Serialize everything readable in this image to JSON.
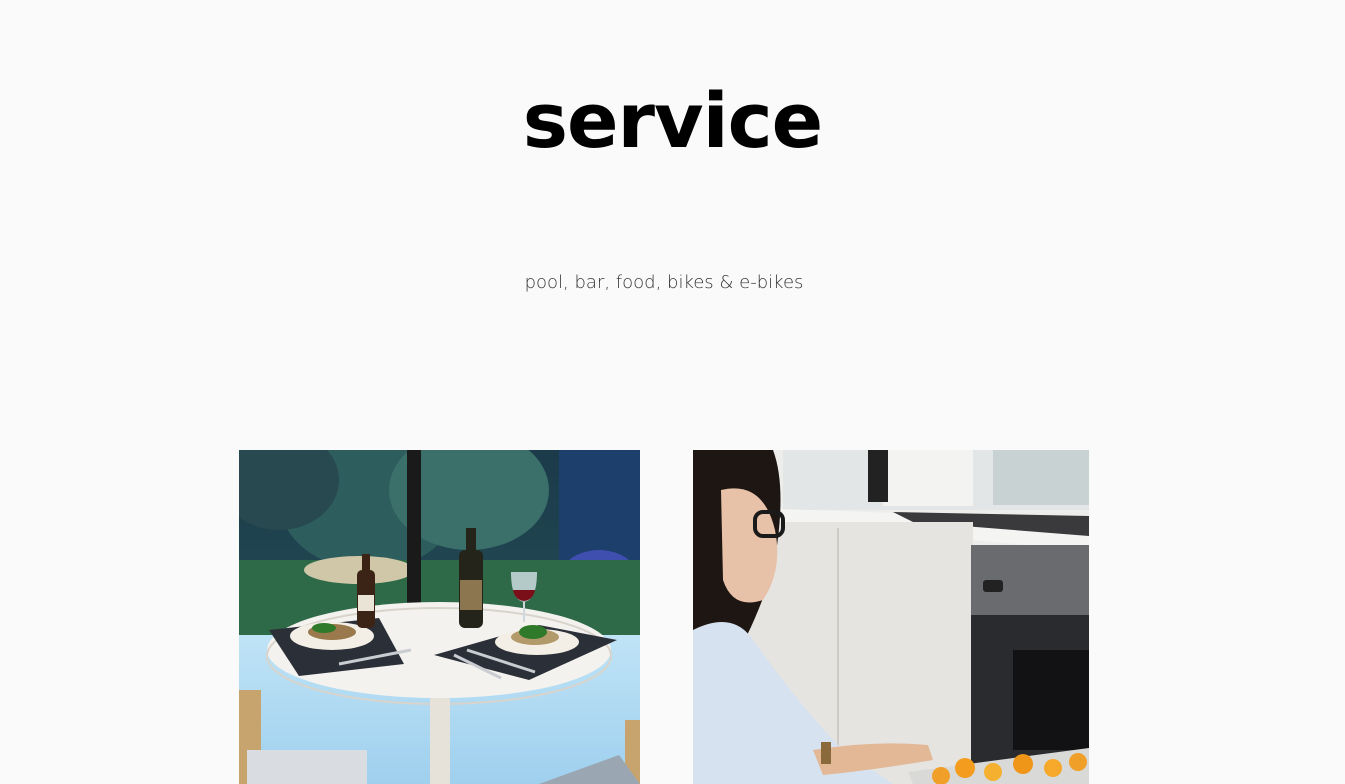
{
  "section": {
    "title": "service",
    "subtitle": "pool, bar, food, bikes & e-bikes"
  },
  "gallery": {
    "photos": [
      {
        "subject": "dining-table-with-wine-and-food"
      },
      {
        "subject": "woman-taking-food-from-oven"
      }
    ]
  },
  "colors": {
    "background": "#fafafa",
    "title": "#000000",
    "subtitle": "#333333"
  }
}
